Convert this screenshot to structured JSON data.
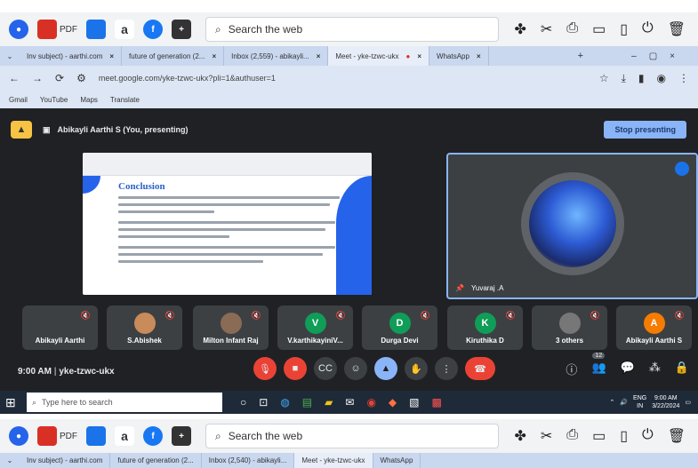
{
  "system_bar": {
    "pdf_label": "PDF",
    "search_placeholder": "Search the web"
  },
  "tabs": [
    {
      "label": "Inv subject) - aarthi.com",
      "active": false
    },
    {
      "label": "future of generation (2...",
      "active": false
    },
    {
      "label": "Inbox (2,559) - abikayli...",
      "active": false
    },
    {
      "label": "Meet - yke-tzwc-ukx",
      "active": true
    },
    {
      "label": "WhatsApp",
      "active": false
    }
  ],
  "tabs_bottom": [
    {
      "label": "Inv subject) - aarthi.com"
    },
    {
      "label": "future of generation (2..."
    },
    {
      "label": "Inbox (2,540) - abikayli..."
    },
    {
      "label": "Meet - yke-tzwc-ukx"
    },
    {
      "label": "WhatsApp"
    }
  ],
  "address_bar": {
    "url": "meet.google.com/yke-tzwc-ukx?pli=1&authuser=1"
  },
  "bookmarks": [
    "Gmail",
    "YouTube",
    "Maps",
    "Translate"
  ],
  "meet": {
    "presenting_text": "Abikayli Aarthi S (You, presenting)",
    "stop_button": "Stop presenting",
    "slide_title": "Conclusion",
    "speaker_name": "Yuvaraj .A",
    "meeting_time": "9:00 AM",
    "meeting_code": "yke-tzwc-ukx",
    "participants_badge": "12",
    "participants": [
      {
        "name": "Abikayli Aarthi",
        "initial": "",
        "color": "#3c4043"
      },
      {
        "name": "S.Abishek",
        "initial": "",
        "color": "#c98b5a"
      },
      {
        "name": "Milton Infant Raj",
        "initial": "",
        "color": "#8a6b55"
      },
      {
        "name": "V.karthikayiniV...",
        "initial": "V",
        "color": "#0f9d58"
      },
      {
        "name": "Durga Devi",
        "initial": "D",
        "color": "#0f9d58"
      },
      {
        "name": "Kiruthika D",
        "initial": "K",
        "color": "#0f9d58"
      },
      {
        "name": "3 others",
        "initial": "",
        "color": "#777"
      },
      {
        "name": "Abikayli Aarthi S",
        "initial": "A",
        "color": "#f57c00"
      }
    ]
  },
  "taskbar": {
    "search_placeholder": "Type here to search",
    "lang": "ENG",
    "lang_sub": "IN",
    "time": "9:00 AM",
    "date": "3/22/2024"
  }
}
